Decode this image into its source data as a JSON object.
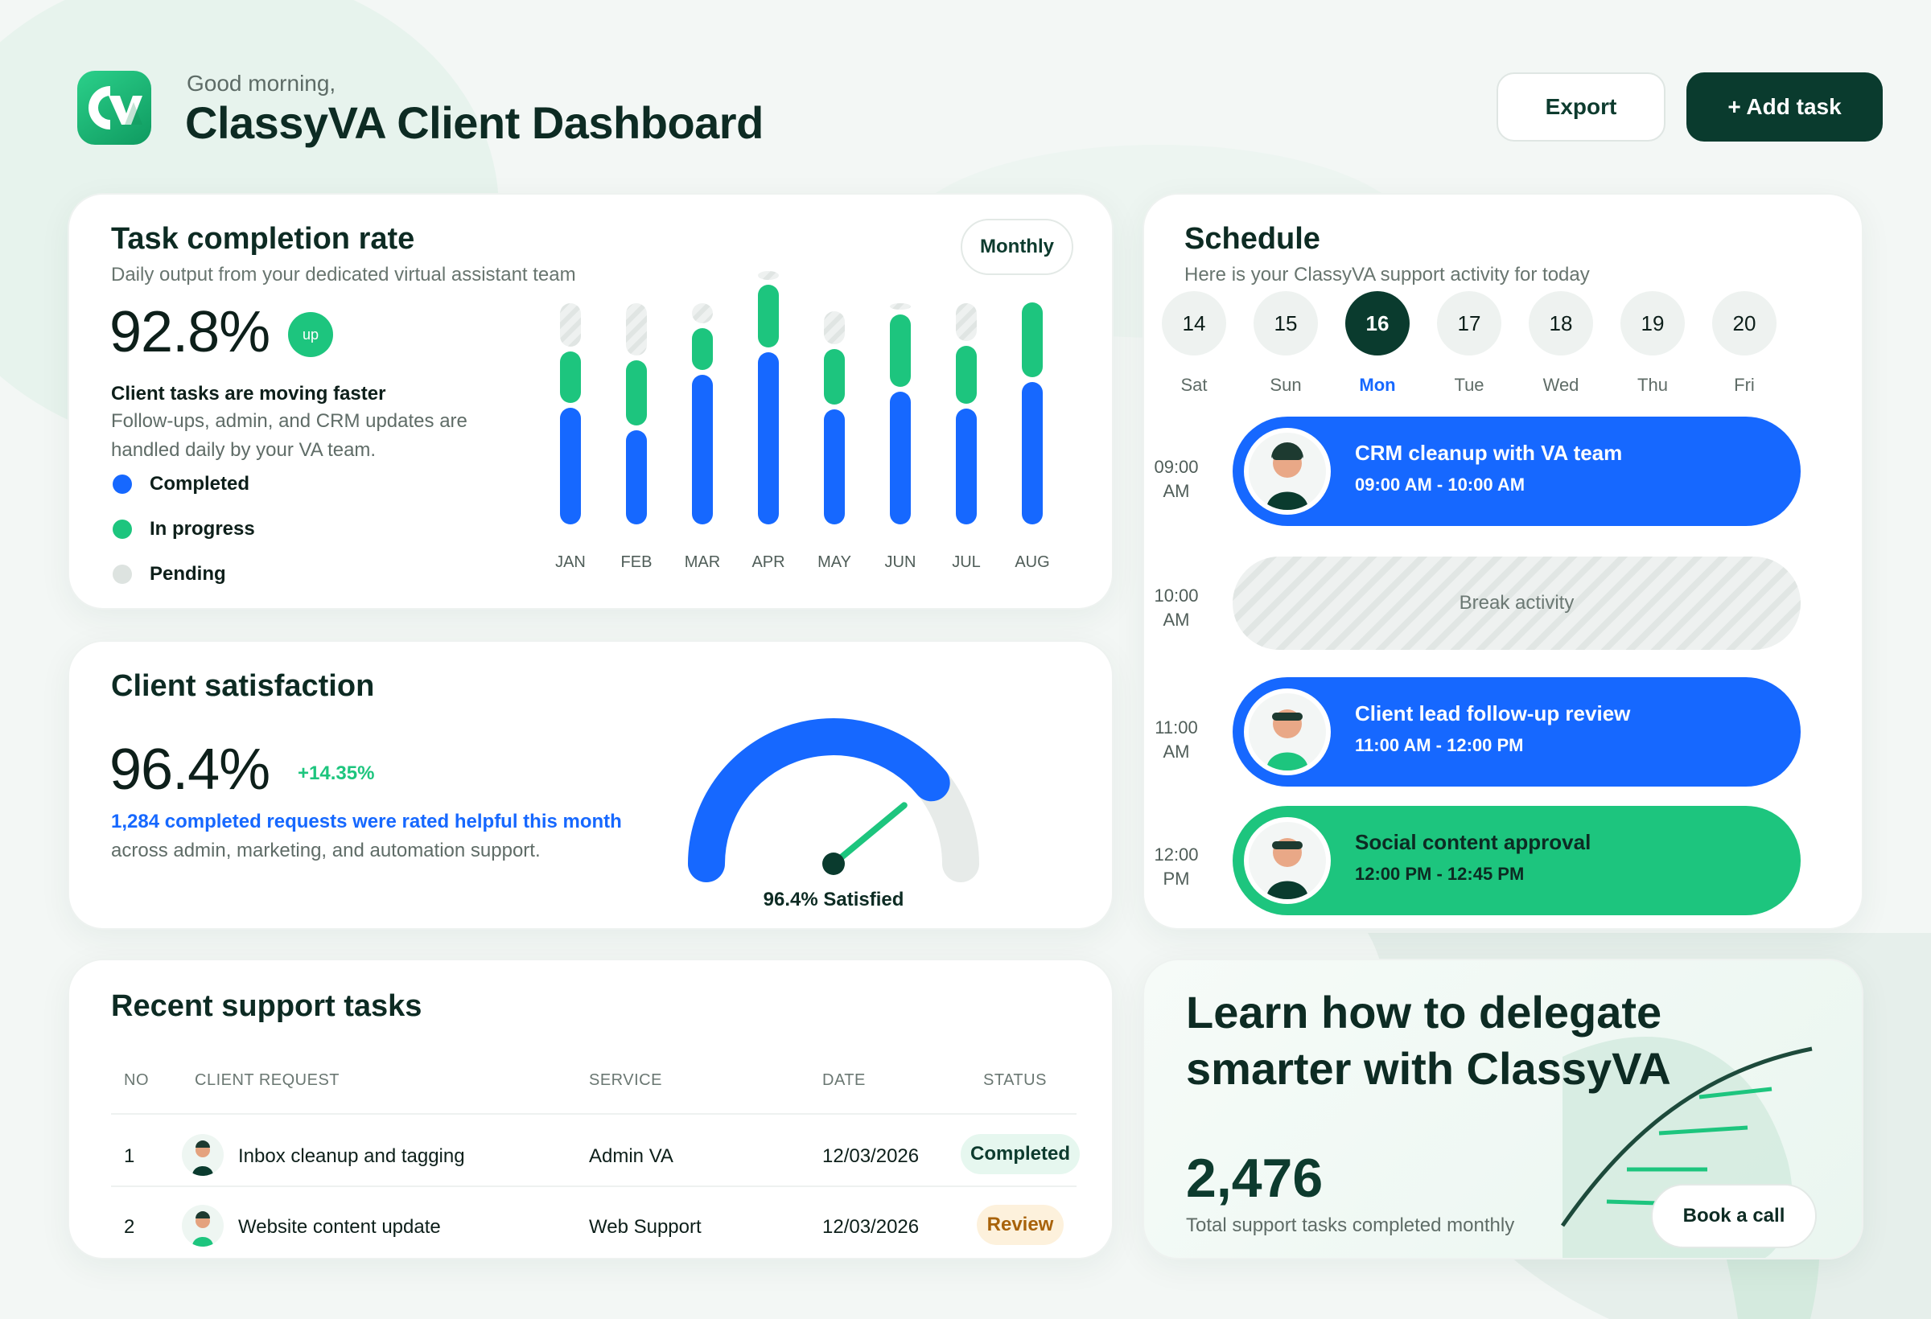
{
  "header": {
    "greeting": "Good morning,",
    "title": "ClassyVA Client Dashboard",
    "logo_text": "CVA",
    "export_label": "Export",
    "add_task_label": "+ Add task"
  },
  "task_completion": {
    "title": "Task completion rate",
    "subtitle": "Daily output from your dedicated virtual assistant team",
    "period_label": "Monthly",
    "rate": "92.8%",
    "trend_badge": "up",
    "headline": "Client tasks are moving faster",
    "description": "Follow-ups, admin, and CRM updates are handled daily by your VA team.",
    "legend": [
      {
        "label": "Completed",
        "color": "#1668ff"
      },
      {
        "label": "In progress",
        "color": "#1dc57e"
      },
      {
        "label": "Pending",
        "color": "#dde3e0"
      }
    ]
  },
  "chart_data": {
    "type": "bar",
    "stacked": true,
    "categories": [
      "JAN",
      "FEB",
      "MAR",
      "APR",
      "MAY",
      "JUN",
      "JUL",
      "AUG"
    ],
    "series": [
      {
        "name": "Completed",
        "color": "#1668ff",
        "values": [
          145,
          117,
          186,
          214,
          143,
          165,
          144,
          177
        ]
      },
      {
        "name": "In progress",
        "color": "#1dc57e",
        "values": [
          70,
          87,
          58,
          84,
          75,
          96,
          78,
          99
        ]
      },
      {
        "name": "Pending",
        "color": "#dde3e0",
        "values": [
          60,
          71,
          31,
          17,
          47,
          14,
          53,
          0
        ]
      }
    ],
    "ylim": [
      0,
      290
    ],
    "grid": false,
    "legend_position": "left"
  },
  "satisfaction": {
    "title": "Client satisfaction",
    "score": "96.4%",
    "delta": "+14.35%",
    "highlight": "1,284 completed requests were rated helpful this month",
    "detail": "across admin, marketing, and automation support.",
    "gauge_value": 96.4,
    "gauge_label": "96.4% Satisfied"
  },
  "recent_tasks": {
    "title": "Recent support tasks",
    "columns": [
      "NO",
      "CLIENT REQUEST",
      "SERVICE",
      "DATE",
      "STATUS"
    ],
    "rows": [
      {
        "no": "1",
        "request": "Inbox cleanup and tagging",
        "service": "Admin VA",
        "date": "12/03/2026",
        "status": "Completed"
      },
      {
        "no": "2",
        "request": "Website content update",
        "service": "Web Support",
        "date": "12/03/2026",
        "status": "Review"
      }
    ]
  },
  "schedule": {
    "title": "Schedule",
    "subtitle": "Here is your ClassyVA support activity for today",
    "days": [
      {
        "num": "14",
        "label": "Sat",
        "active": false
      },
      {
        "num": "15",
        "label": "Sun",
        "active": false
      },
      {
        "num": "16",
        "label": "Mon",
        "active": true
      },
      {
        "num": "17",
        "label": "Tue",
        "active": false
      },
      {
        "num": "18",
        "label": "Wed",
        "active": false
      },
      {
        "num": "19",
        "label": "Thu",
        "active": false
      },
      {
        "num": "20",
        "label": "Fri",
        "active": false
      }
    ],
    "time_slots": [
      {
        "time": "09:00",
        "period": "AM"
      },
      {
        "time": "10:00",
        "period": "AM"
      },
      {
        "time": "11:00",
        "period": "AM"
      },
      {
        "time": "12:00",
        "period": "PM"
      }
    ],
    "events": [
      {
        "title": "CRM cleanup with VA team",
        "time": "09:00 AM - 10:00 AM",
        "color": "#1668ff"
      },
      {
        "title": "Client lead follow-up review",
        "time": "11:00 AM - 12:00 PM",
        "color": "#1668ff"
      },
      {
        "title": "Social content approval",
        "time": "12:00 PM - 12:45 PM",
        "color": "#1dc57e"
      }
    ],
    "break_label": "Break activity"
  },
  "learn": {
    "title": "Learn how to delegate smarter with ClassyVA",
    "stat": "2,476",
    "stat_label": "Total support tasks completed monthly",
    "cta_label": "Book a call"
  },
  "colors": {
    "accent_blue": "#1668ff",
    "accent_green": "#1dc57e",
    "dark_green": "#0a3b2e"
  }
}
